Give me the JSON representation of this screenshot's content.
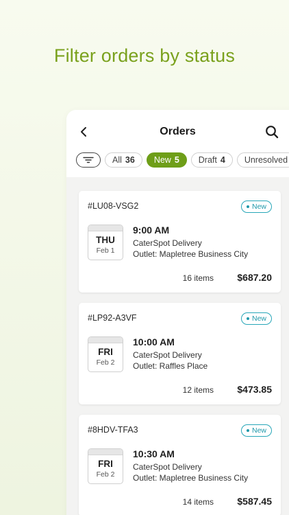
{
  "headline": "Filter orders by status",
  "header": {
    "title": "Orders"
  },
  "filters": [
    {
      "label": "All",
      "count": "36"
    },
    {
      "label": "New",
      "count": "5"
    },
    {
      "label": "Draft",
      "count": "4"
    },
    {
      "label": "Unresolved",
      "count": ""
    }
  ],
  "colors": {
    "accent": "#6e9e18",
    "headline": "#7aa11d",
    "badge": "#1e98aa"
  },
  "orders": [
    {
      "id": "#LU08-VSG2",
      "status": "New",
      "day": "THU",
      "date": "Feb 1",
      "time": "9:00 AM",
      "vendor": "CaterSpot Delivery",
      "outlet": "Outlet: Mapletree Business City",
      "items": "16 items",
      "total": "$687.20"
    },
    {
      "id": "#LP92-A3VF",
      "status": "New",
      "day": "FRI",
      "date": "Feb 2",
      "time": "10:00 AM",
      "vendor": "CaterSpot Delivery",
      "outlet": "Outlet: Raffles Place",
      "items": "12 items",
      "total": "$473.85"
    },
    {
      "id": "#8HDV-TFA3",
      "status": "New",
      "day": "FRI",
      "date": "Feb 2",
      "time": "10:30 AM",
      "vendor": "CaterSpot Delivery",
      "outlet": "Outlet: Mapletree Business City",
      "items": "14 items",
      "total": "$587.45"
    }
  ]
}
